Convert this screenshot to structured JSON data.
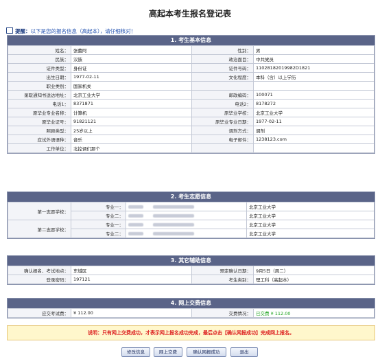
{
  "page_title": "高起本考生报名登记表",
  "tip": {
    "label": "提醒：",
    "message": "以下是您的报名信息（高起本），请仔细核对！"
  },
  "sections": {
    "basic": "1. 考生基本信息",
    "wish": "2. 考生志愿信息",
    "other": "3. 其它辅助信息",
    "pay": "4. 网上交费信息"
  },
  "basic": {
    "name_l": "姓名：",
    "name_v": "张蕾阿",
    "gender_l": "性别：",
    "gender_v": "男",
    "ethnic_l": "民族：",
    "ethnic_v": "汉族",
    "politics_l": "政治面目：",
    "politics_v": "中共党员",
    "idtype_l": "证件类型：",
    "idtype_v": "身份证",
    "idno_l": "证件号码：",
    "idno_v": "11028182019982D1821",
    "birth_l": "出生日期：",
    "birth_v": "1977-02-11",
    "edu_l": "文化程度：",
    "edu_v": "本科（含）以上学历",
    "job_l": "职业类别：",
    "job_v": "国家机关",
    "addr_l": "录取通知书送达地址：",
    "addr_v": "北京工业大学",
    "zip_l": "邮政编码：",
    "zip_v": "100071",
    "tel_l": "电话1：",
    "tel_v": "8371871",
    "tel2_l": "电话2：",
    "tel2_v": "8178272",
    "major_l": "原毕业专业名称：",
    "major_v": "计算机",
    "school_l": "原毕业学校：",
    "school_v": "北京工业大学",
    "certno_l": "原毕业证号：",
    "certno_v": "91821121",
    "graddate_l": "原毕业专业日期：",
    "graddate_v": "1977-02-11",
    "bonus_l": "照顾类型：",
    "bonus_v": "25岁以上",
    "adjust_l": "调剂方式：",
    "adjust_v": "调剂",
    "lang_l": "应试外语语种：",
    "lang_v": "音乐",
    "email_l": "电子邮件：",
    "email_v": "1238123.com",
    "work_l": "工作单位：",
    "work_v": "北控调们那个"
  },
  "wish": {
    "first_l": "第一志愿学校：",
    "second_l": "第二志愿学校：",
    "major1_l": "专业一：",
    "major2_l": "专业二：",
    "school_v": "北京工业大学"
  },
  "other": {
    "confirm_l": "确认报名、考试地点：",
    "confirm_v": "东城区",
    "date_l": "预定确认日期：",
    "date_v": "9月5日（周二）",
    "pwd_l": "登录密码：",
    "pwd_v": "197121",
    "cat_l": "考生类别：",
    "cat_v": "理工科（高起本）"
  },
  "pay": {
    "fee_l": "应交考试费：",
    "fee_v": "¥ 112.00",
    "status_l": "交费情况：",
    "status_v": "已交费 ¥ 112.00"
  },
  "notice": "说明：只有网上交费成功，才表示网上报名成功完成，最后点击【确认网报成功】完成网上报名。",
  "buttons": {
    "edit": "修改信息",
    "pay": "网上交费",
    "confirm": "确认网报成功",
    "exit": "退出"
  },
  "colors": {
    "header_bg": "#5a6488",
    "notice_text": "#dd2222",
    "paid_text": "#18a018"
  }
}
